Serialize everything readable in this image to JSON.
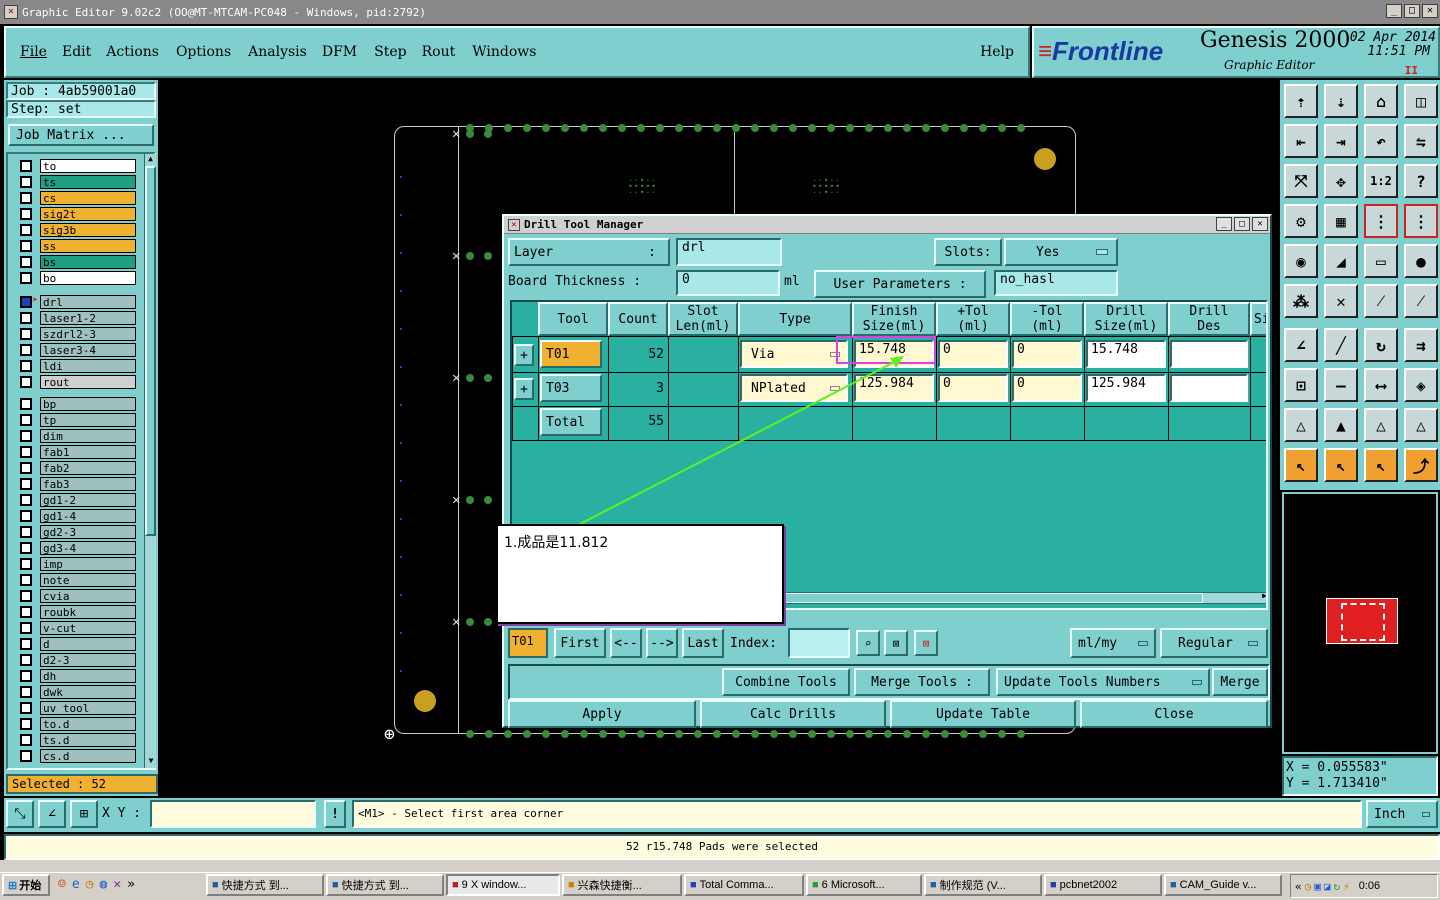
{
  "window": {
    "title": "Graphic Editor 9.02c2  (OO@MT-MTCAM-PC048 - Windows, pid:2792)"
  },
  "menu": [
    "File",
    "Edit",
    "Actions",
    "Options",
    "Analysis",
    "DFM",
    "Step",
    "Rout",
    "Windows"
  ],
  "help": "Help",
  "brand": {
    "logo": "Frontline",
    "product": "Genesis 2000",
    "subtitle": "Graphic Editor",
    "date": "02 Apr 2014",
    "time": "11:51 PM"
  },
  "job": {
    "job_label": "Job :  4ab59001a0",
    "step_label": "Step:  set",
    "matrix_button": "Job Matrix ..."
  },
  "layers_top": [
    {
      "name": "to",
      "color": "#ffffff"
    },
    {
      "name": "ts",
      "color": "#20a080"
    },
    {
      "name": "cs",
      "color": "#f0b030"
    },
    {
      "name": "sig2t",
      "color": "#f0b030"
    },
    {
      "name": "sig3b",
      "color": "#f0b030"
    },
    {
      "name": "ss",
      "color": "#f0b030"
    },
    {
      "name": "bs",
      "color": "#20a080"
    },
    {
      "name": "bo",
      "color": "#ffffff"
    }
  ],
  "layers_mid": [
    {
      "name": "drl",
      "color": "#a0c0c0"
    },
    {
      "name": "laser1-2",
      "color": "#a0c0c0"
    },
    {
      "name": "szdrl2-3",
      "color": "#a0c0c0"
    },
    {
      "name": "laser3-4",
      "color": "#a0c0c0"
    },
    {
      "name": "ldi",
      "color": "#a0c0c0"
    },
    {
      "name": "rout",
      "color": "#d0d0d0"
    }
  ],
  "layers_bottom": [
    "bp",
    "tp",
    "dim",
    "fab1",
    "fab2",
    "fab3",
    "gd1-2",
    "gd1-4",
    "gd2-3",
    "gd3-4",
    "imp",
    "note",
    "cvia",
    "roubk",
    "v-cut",
    "d",
    "d2-3",
    "dh",
    "dwk",
    "uv_tool",
    "to.d",
    "ts.d",
    "cs.d"
  ],
  "selected": "Selected : 52",
  "dialog": {
    "title": "Drill Tool Manager",
    "layer_label": "Layer",
    "layer_colon": ":",
    "layer_value": "drl",
    "slots_label": "Slots:",
    "slots_value": "Yes",
    "thickness_label": "Board Thickness :",
    "thickness_value": "0",
    "thickness_unit": "ml",
    "user_params_label": "User Parameters :",
    "user_params_value": "no_hasl",
    "headers": [
      "Tool",
      "Count",
      "Slot\nLen(ml)",
      "Type",
      "Finish\nSize(ml)",
      "+Tol\n(ml)",
      "-Tol\n(ml)",
      "Drill\nSize(ml)",
      "Drill\nDes",
      "Si"
    ],
    "rows": [
      {
        "tool": "T01",
        "count": "52",
        "type": "Via",
        "finish": "15.748",
        "ptol": "0",
        "mtol": "0",
        "drill": "15.748",
        "des": ""
      },
      {
        "tool": "T03",
        "count": "3",
        "type": "NPlated",
        "finish": "125.984",
        "ptol": "0",
        "mtol": "0",
        "drill": "125.984",
        "des": ""
      }
    ],
    "total_label": "Total",
    "total_count": "55",
    "current_tool": "T01",
    "nav": {
      "first": "First",
      "prev": "<--",
      "next": "-->",
      "last": "Last",
      "index_label": "Index:"
    },
    "units": "ml/my",
    "mode": "Regular",
    "combine": "Combine Tools",
    "merge_tools": "Merge Tools :",
    "update_numbers": "Update Tools Numbers",
    "merge": "Merge",
    "apply": "Apply",
    "calc": "Calc Drills",
    "update_table": "Update Table",
    "close": "Close"
  },
  "annotation": "1.成品是11.812",
  "coords": {
    "x": "X = 0.055583\"",
    "y": "Y = 1.713410\""
  },
  "command": {
    "xy_label": "X Y :",
    "prompt": "<M1> - Select first area corner",
    "units": "Inch"
  },
  "status": "52 r15.748 Pads were selected",
  "taskbar": {
    "start": "开始",
    "items": [
      "快捷方式 到...",
      "快捷方式 到...",
      "9 X window...",
      "兴森快捷衡...",
      "Total Comma...",
      "6 Microsoft...",
      "制作规范 (V...",
      "pcbnet2002",
      "CAM_Guide v..."
    ],
    "clock": "0:06"
  }
}
